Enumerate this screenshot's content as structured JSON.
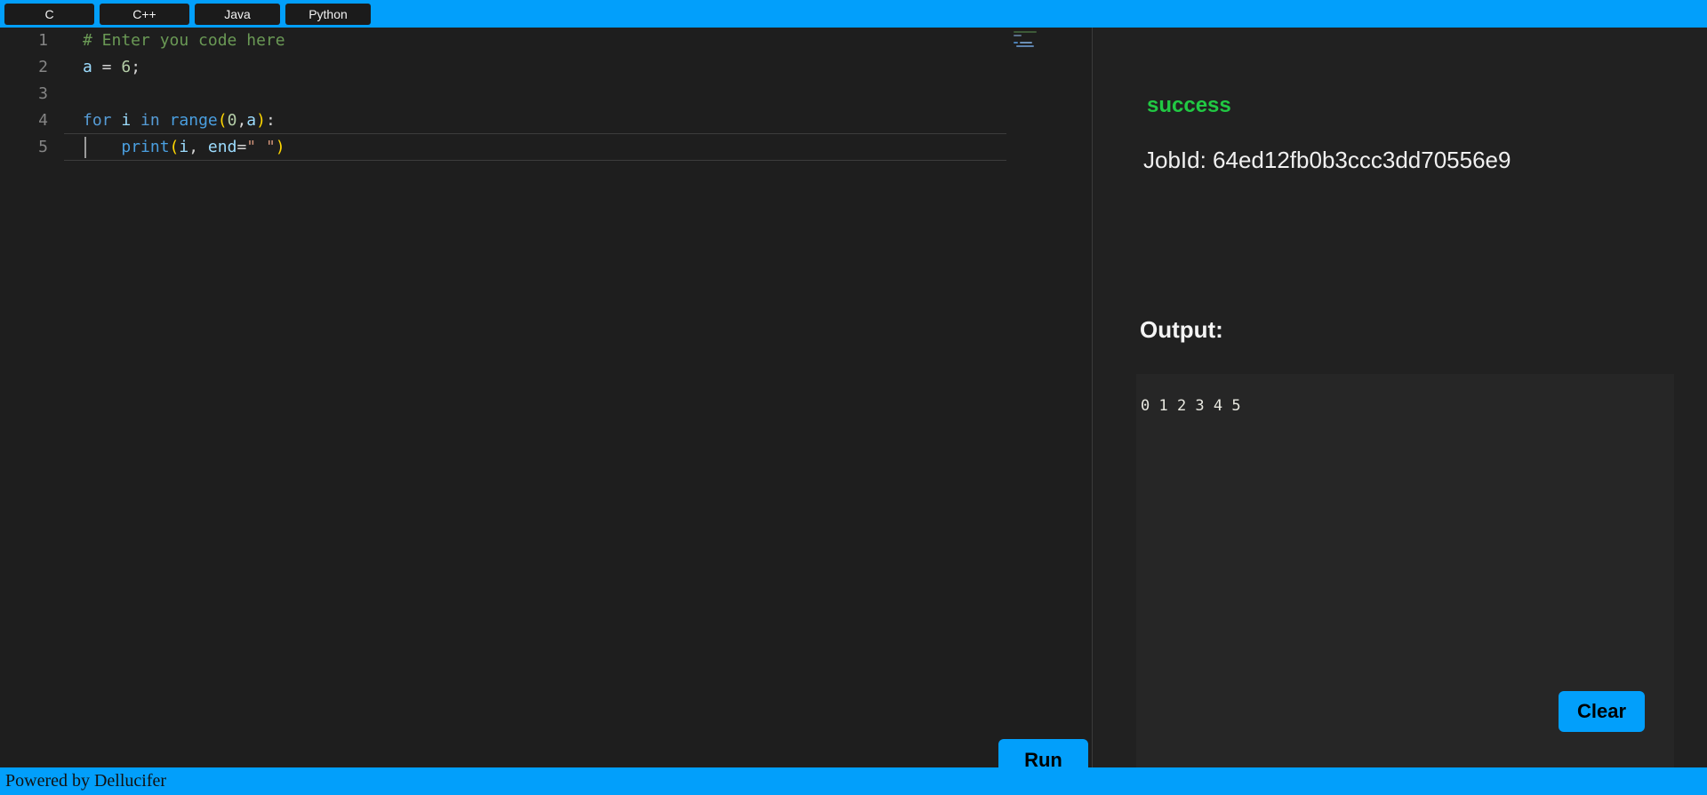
{
  "app": {
    "theme_accent": "#029ffb",
    "editor_bg": "#1e1e1e",
    "panel_bg": "#212121",
    "output_bg": "#262626"
  },
  "tabbar": {
    "tabs": [
      {
        "label": "C",
        "id": "c"
      },
      {
        "label": "C++",
        "id": "cpp"
      },
      {
        "label": "Java",
        "id": "java"
      },
      {
        "label": "Python",
        "id": "python"
      }
    ]
  },
  "editor": {
    "language": "Python",
    "line_numbers": [
      "1",
      "2",
      "3",
      "4",
      "5"
    ],
    "lines": [
      {
        "n": "1",
        "text": "# Enter you code here"
      },
      {
        "n": "2",
        "text": "a = 6;"
      },
      {
        "n": "3",
        "text": ""
      },
      {
        "n": "4",
        "text": "for i in range(0,a):"
      },
      {
        "n": "5",
        "text": "    print(i, end=\" \")"
      }
    ],
    "active_line": 5,
    "tokens": {
      "l1_comment": "# Enter you code here",
      "l2_var": "a",
      "l2_eq": " = ",
      "l2_num": "6",
      "l2_semi": ";",
      "l4_for": "for",
      "l4_i": " i ",
      "l4_in": "in",
      "l4_space": " ",
      "l4_range": "range",
      "l4_paren_open": "(",
      "l4_zero": "0",
      "l4_comma": ",",
      "l4_a": "a",
      "l4_paren_close": ")",
      "l4_colon": ":",
      "l5_indent": "    ",
      "l5_print": "print",
      "l5_paren_open": "(",
      "l5_i": "i",
      "l5_comma": ", ",
      "l5_end": "end",
      "l5_eq": "=",
      "l5_str": "\" \"",
      "l5_paren_close": ")"
    }
  },
  "controls": {
    "run_label": "Run",
    "clear_label": "Clear"
  },
  "result": {
    "status": "success",
    "status_color": "#21c943",
    "job_id_label": "JobId: 64ed12fb0b3ccc3dd70556e9",
    "output_label": "Output:",
    "output_text": "0 1 2 3 4 5"
  },
  "footer": {
    "text": "Powered by Dellucifer"
  }
}
